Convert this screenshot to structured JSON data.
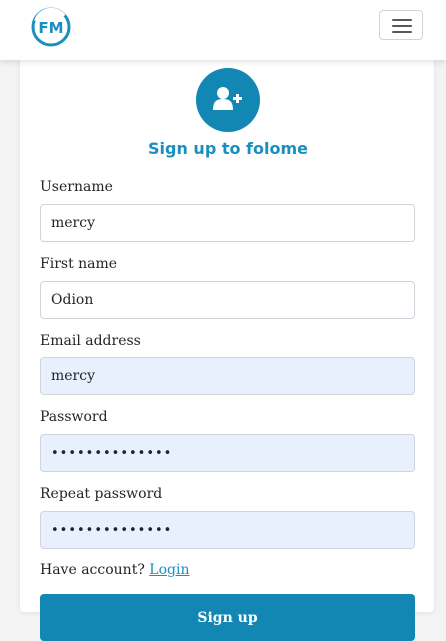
{
  "brand": {
    "logo_text": "FM",
    "color": "#1a8fc1"
  },
  "navbar": {
    "menu_icon": "hamburger-icon"
  },
  "form": {
    "icon": "add-user-icon",
    "title": "Sign up to folome",
    "username_label": "Username",
    "username_value": "mercy",
    "firstname_label": "First name",
    "firstname_value": "Odion",
    "email_label": "Email address",
    "email_value": "mercy",
    "password_label": "Password",
    "password_value": "••••••••••••••",
    "repeat_label": "Repeat password",
    "repeat_value": "••••••••••••••",
    "have_account": "Have account?",
    "login_link": "Login",
    "submit_label": "Sign up"
  },
  "colors": {
    "primary": "#1387b4",
    "autofill": "#e8f0fe"
  }
}
